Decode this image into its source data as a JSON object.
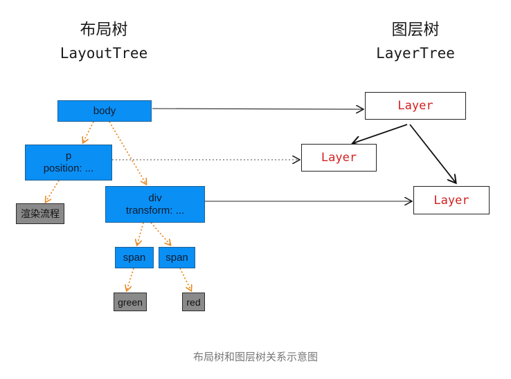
{
  "headings": {
    "layout_zh": "布局树",
    "layout_en": "LayoutTree",
    "layer_zh": "图层树",
    "layer_en": "LayerTree"
  },
  "layout_nodes": {
    "body": "body",
    "p": "p",
    "p_style": "position: ...",
    "div": "div",
    "div_style": "transform: ...",
    "span1": "span",
    "span2": "span",
    "render_flow": "渲染流程",
    "green": "green",
    "red": "red"
  },
  "layers": {
    "top": "Layer",
    "left": "Layer",
    "right": "Layer"
  },
  "caption": "布局树和图层树关系示意图",
  "colors": {
    "layout_node_fill": "#0a8ff5",
    "leaf_fill": "#8a8a8a",
    "layer_text": "#d42020",
    "tree_edge": "#e8871e",
    "mapping_edge": "#222222"
  }
}
